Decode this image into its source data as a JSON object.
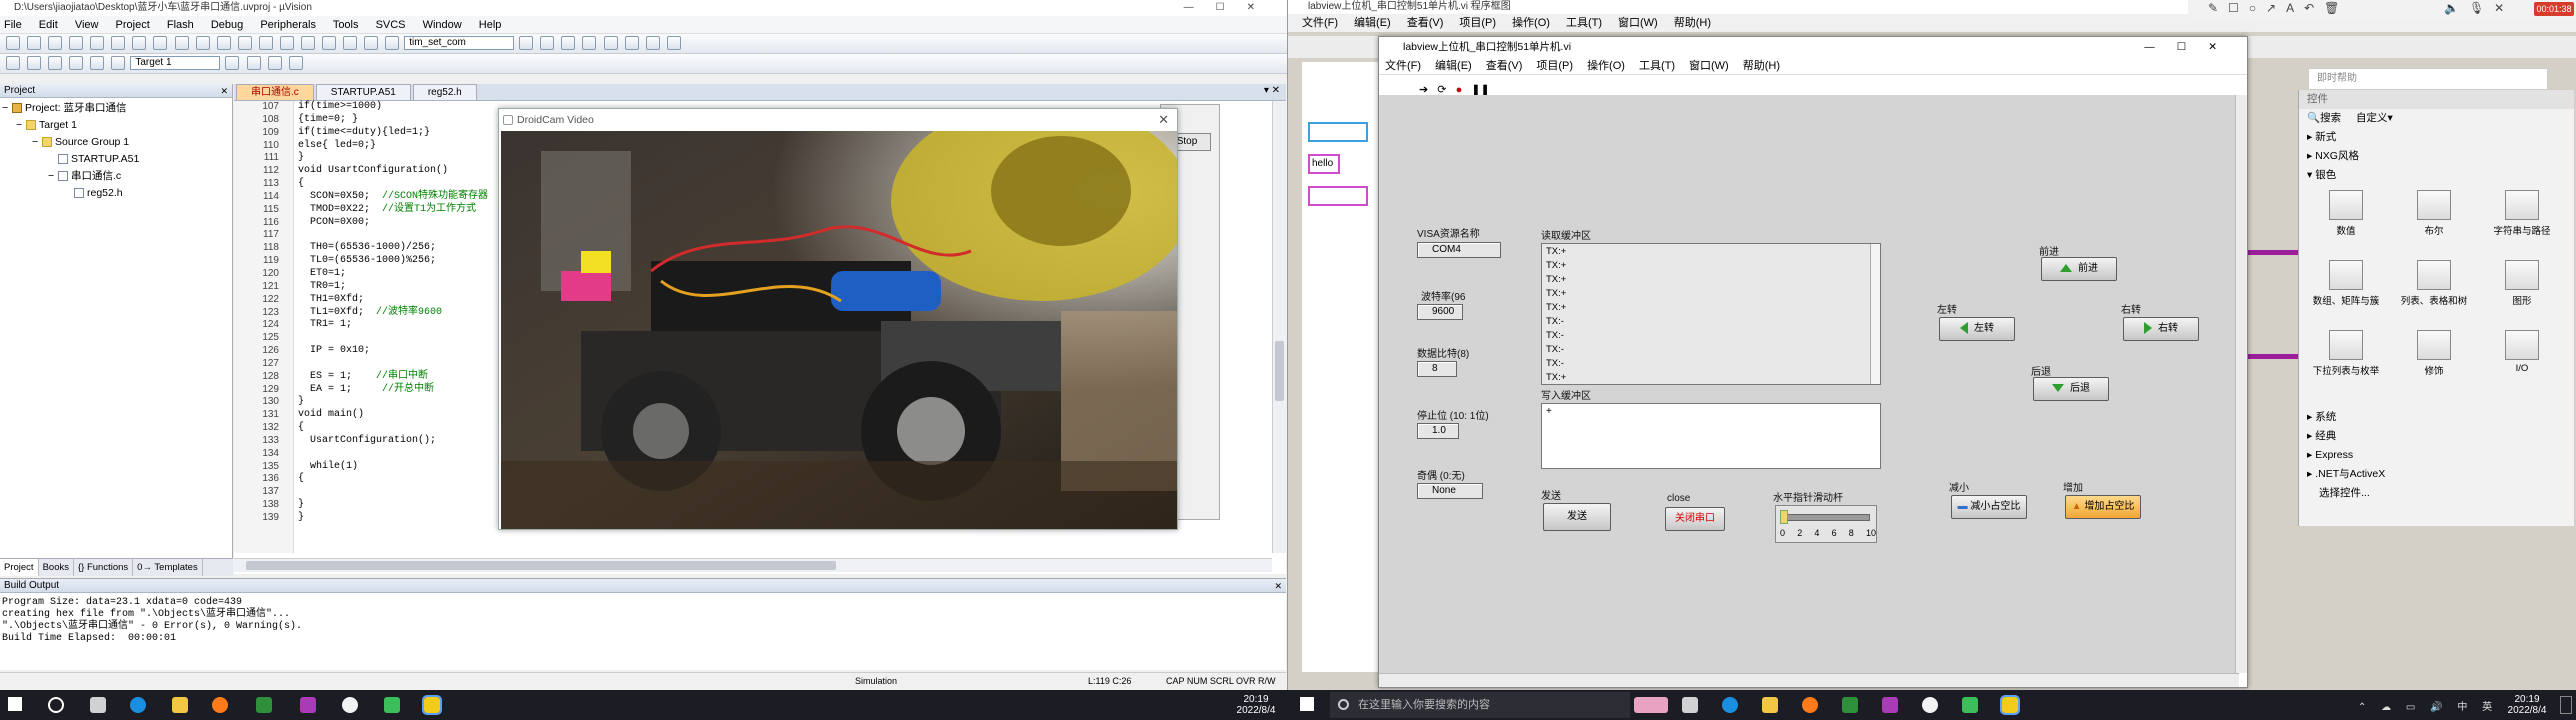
{
  "keil": {
    "title": "D:\\Users\\jiaojiatao\\Desktop\\蓝牙小车\\蓝牙串口通信.uvproj - µVision",
    "menu": [
      "File",
      "Edit",
      "View",
      "Project",
      "Flash",
      "Debug",
      "Peripherals",
      "Tools",
      "SVCS",
      "Window",
      "Help"
    ],
    "target_combo": "Target 1",
    "find_combo": "tim_set_com",
    "project_header": "Project",
    "tree": [
      "Project: 蓝牙串口通信",
      "Target 1",
      "Source Group 1",
      "STARTUP.A51",
      "串口通信.c",
      "reg52.h"
    ],
    "bottom_tabs": [
      "Project",
      "Books",
      "{} Functions",
      "0→ Templates"
    ],
    "editor_tabs": [
      "串口通信.c",
      "STARTUP.A51",
      "reg52.h"
    ],
    "line_numbers": [
      "107",
      "108",
      "109",
      "110",
      "111",
      "112",
      "113",
      "114",
      "115",
      "116",
      "117",
      "118",
      "119",
      "120",
      "121",
      "122",
      "123",
      "124",
      "125",
      "126",
      "127",
      "128",
      "129",
      "130",
      "131",
      "132",
      "133",
      "134",
      "135",
      "136",
      "137",
      "138",
      "139"
    ],
    "code_lines": [
      "if(time>=1000)",
      "{time=0; }",
      "if(time<=duty){led=1;}",
      "else{ led=0;}",
      "}",
      "void UsartConfiguration()",
      "{",
      "  SCON=0X50;  //SCON特殊功能寄存器",
      "  TMOD=0X22;  //设置T1为工作方式",
      "  PCON=0X00;",
      "",
      "  TH0=(65536-1000)/256;",
      "  TL0=(65536-1000)%256;",
      "  ET0=1;",
      "  TR0=1;",
      "  TH1=0Xfd;",
      "  TL1=0Xfd;  //波特率9600",
      "  TR1= 1;",
      "",
      "  IP = 0x10;",
      "",
      "  ES = 1;    //串口中断",
      "  EA = 1;     //开总中断",
      "}",
      "void main()",
      "{",
      "  UsartConfiguration();",
      "",
      "  while(1)",
      "{",
      "",
      "}",
      "}"
    ],
    "build_header": "Build Output",
    "build_lines": [
      "Program Size: data=23.1 xdata=0 code=439",
      "creating hex file from \".\\Objects\\蓝牙串口通信\"...",
      "\".\\Objects\\蓝牙串口通信\" - 0 Error(s), 0 Warning(s).",
      "Build Time Elapsed:  00:00:01"
    ],
    "status": {
      "mode": "Simulation",
      "position": "L:119 C:26",
      "flags": "CAP  NUM  SCRL  OVR  R/W"
    },
    "stop_label": "Stop"
  },
  "droidcam": {
    "title": "DroidCam Video"
  },
  "taskbar_left": {
    "time": "20:19",
    "date": "2022/8/4"
  },
  "taskbar_right": {
    "search_placeholder": "在这里输入你要搜索的内容",
    "time": "20:19",
    "date": "2022/8/4"
  },
  "recorder": {
    "time": "00:01:38"
  },
  "labview": {
    "back_title": "labview上位机_串口控制51单片机.vi 程序框图",
    "back_menu": [
      "文件(F)",
      "编辑(E)",
      "查看(V)",
      "项目(P)",
      "操作(O)",
      "工具(T)",
      "窗口(W)",
      "帮助(H)"
    ],
    "back_help": "即时帮助",
    "back_hello": "hello",
    "front_title": "labview上位机_串口控制51单片机.vi",
    "front_menu": [
      "文件(F)",
      "编辑(E)",
      "查看(V)",
      "项目(P)",
      "操作(O)",
      "工具(T)",
      "窗口(W)",
      "帮助(H)"
    ],
    "visa_label": "VISA资源名称",
    "visa_value": "COM4",
    "baud_label": "波特率(96",
    "baud_value": "9600",
    "databits_label": "数据比特(8)",
    "databits_value": "8",
    "stopbits_label": "停止位 (10: 1位)",
    "stopbits_value": "1.0",
    "parity_label": "奇偶 (0:无)",
    "parity_value": "None",
    "read_label": "读取缓冲区",
    "read_lines": [
      "TX:+",
      "TX:+",
      "TX:+",
      "TX:+",
      "TX:+",
      "TX:-",
      "TX:-",
      "TX:-",
      "TX:-",
      "TX:+"
    ],
    "write_label": "写入缓冲区",
    "write_value": "+",
    "send_label": "发送",
    "send_button": "发送",
    "close_label": "close",
    "close_button": "关闭串口",
    "slider_label": "水平指针滑动杆",
    "slider_ticks": [
      "0",
      "2",
      "4",
      "6",
      "8",
      "10"
    ],
    "slider_value": 0,
    "forward_label": "前进",
    "forward_button": "前进",
    "left_label": "左转",
    "left_button": "左转",
    "right_label": "右转",
    "right_button": "右转",
    "back_label": "后退",
    "back_button": "后退",
    "dec_label": "减小",
    "dec_button": "减小占空比",
    "inc_label": "增加",
    "inc_button": "增加占空比",
    "palette_title": "控件",
    "palette_search": "搜索",
    "palette_custom": "自定义▾",
    "palette_top": [
      "新式",
      "NXG风格",
      "银色"
    ],
    "palette_tiles": [
      "数值",
      "布尔",
      "字符串与路径",
      "数组、矩阵与簇",
      "列表、表格和树",
      "图形",
      "下拉列表与枚举",
      "修饰",
      "I/O"
    ],
    "palette_bottom": [
      "系统",
      "经典",
      "Express",
      ".NET与ActiveX",
      "选择控件..."
    ]
  }
}
